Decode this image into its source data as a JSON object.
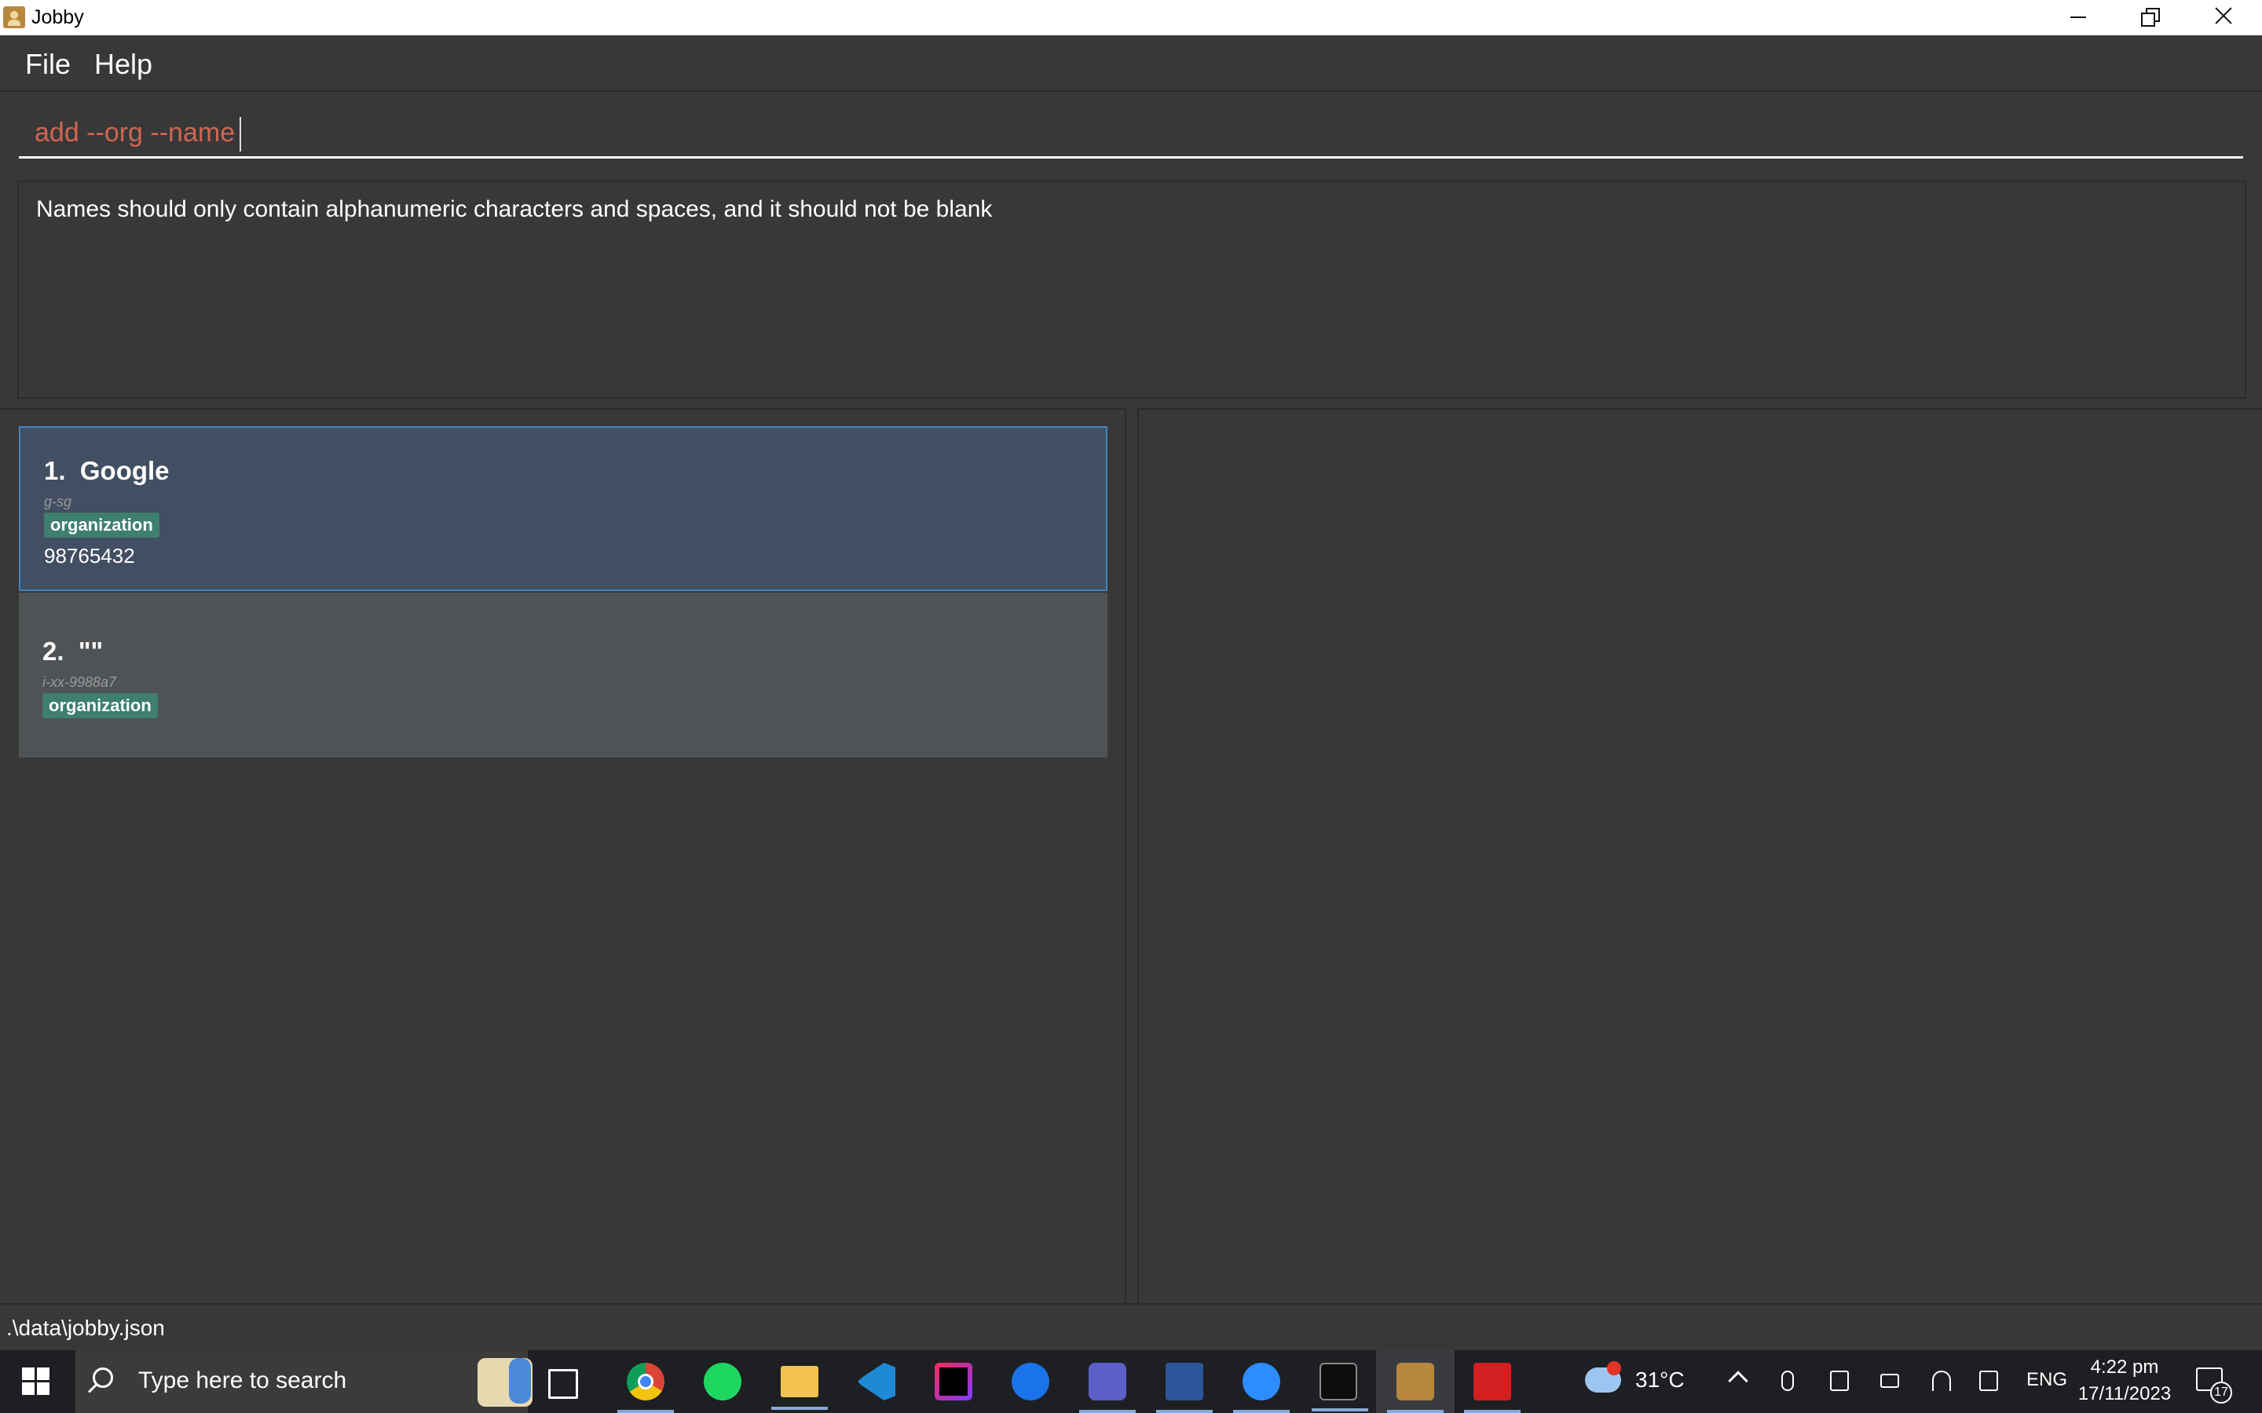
{
  "window": {
    "title": "Jobby",
    "icons": {
      "app": "contact-book-icon",
      "minimize": "minimize-icon",
      "restore": "restore-icon",
      "close": "close-icon"
    }
  },
  "menu": {
    "items": [
      "File",
      "Help"
    ]
  },
  "command": {
    "value": "add --org --name",
    "color": "#d06651"
  },
  "result": {
    "message": "Names should only contain alphanumeric characters and spaces, and it should not be blank"
  },
  "contacts": [
    {
      "index": "1.",
      "name": "Google",
      "id": "g-sg",
      "tag": "organization",
      "phone": "98765432",
      "selected": true
    },
    {
      "index": "2.",
      "name": "\"\"",
      "id": "i-xx-9988a7",
      "tag": "organization",
      "phone": "",
      "selected": false
    }
  ],
  "status": {
    "path": ".\\data\\jobby.json"
  },
  "taskbar": {
    "search_placeholder": "Type here to search",
    "apps": [
      "task-view-icon",
      "chrome-icon",
      "spotify-icon",
      "file-explorer-icon",
      "vscode-icon",
      "intellij-icon",
      "maps-icon",
      "teams-icon",
      "word-icon",
      "zoom-icon",
      "terminal-icon",
      "jobby-icon",
      "acrobat-icon"
    ],
    "weather": {
      "temperature": "31°C",
      "badge": "1"
    },
    "language": "ENG",
    "time": "4:22 pm",
    "date": "17/11/2023",
    "notifications": "17"
  },
  "colors": {
    "background": "#383838",
    "selected_card": "#424e62",
    "card": "#505356",
    "tag": "#3e7f6f",
    "accent": "#3f84c4"
  }
}
